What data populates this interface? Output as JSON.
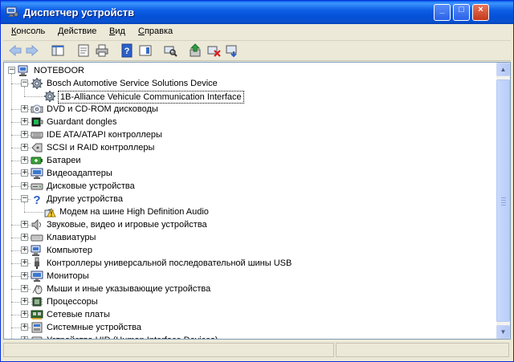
{
  "window": {
    "title": "Диспетчер устройств",
    "minimize": "_",
    "maximize": "□",
    "close": "×"
  },
  "menu": [
    "Консоль",
    "Действие",
    "Вид",
    "Справка"
  ],
  "toolbar": [
    "back-icon",
    "forward-icon",
    "console-tree-icon",
    "properties-icon",
    "print-icon",
    "help-icon",
    "show-hide-icon",
    "scan-hardware-icon",
    "update-driver-icon",
    "uninstall-icon",
    "disable-icon"
  ],
  "tree": [
    {
      "label": "NOTEBOOR",
      "level": 0,
      "expander": "−",
      "icon": "computer"
    },
    {
      "label": "Bosch Automotive Service Solutions Device",
      "level": 1,
      "expander": "−",
      "icon": "gear"
    },
    {
      "label": "1B-Alliance Vehicule Communication Interface",
      "level": 2,
      "expander": "",
      "icon": "gear",
      "selected": true
    },
    {
      "label": "DVD и CD-ROM дисководы",
      "level": 1,
      "expander": "+",
      "icon": "dvd"
    },
    {
      "label": "Guardant dongles",
      "level": 1,
      "expander": "+",
      "icon": "dongle"
    },
    {
      "label": "IDE ATA/ATAPI контроллеры",
      "level": 1,
      "expander": "+",
      "icon": "ide"
    },
    {
      "label": "SCSI и RAID контроллеры",
      "level": 1,
      "expander": "+",
      "icon": "scsi"
    },
    {
      "label": "Батареи",
      "level": 1,
      "expander": "+",
      "icon": "battery"
    },
    {
      "label": "Видеоадаптеры",
      "level": 1,
      "expander": "+",
      "icon": "display"
    },
    {
      "label": "Дисковые устройства",
      "level": 1,
      "expander": "+",
      "icon": "disk"
    },
    {
      "label": "Другие устройства",
      "level": 1,
      "expander": "−",
      "icon": "question"
    },
    {
      "label": "Модем на шине High Definition Audio",
      "level": 2,
      "expander": "",
      "icon": "warning"
    },
    {
      "label": "Звуковые, видео и игровые устройства",
      "level": 1,
      "expander": "+",
      "icon": "sound"
    },
    {
      "label": "Клавиатуры",
      "level": 1,
      "expander": "+",
      "icon": "keyboard"
    },
    {
      "label": "Компьютер",
      "level": 1,
      "expander": "+",
      "icon": "computer"
    },
    {
      "label": "Контроллеры универсальной последовательной шины USB",
      "level": 1,
      "expander": "+",
      "icon": "usb"
    },
    {
      "label": "Мониторы",
      "level": 1,
      "expander": "+",
      "icon": "display"
    },
    {
      "label": "Мыши и иные указывающие устройства",
      "level": 1,
      "expander": "+",
      "icon": "mouse"
    },
    {
      "label": "Процессоры",
      "level": 1,
      "expander": "+",
      "icon": "cpu"
    },
    {
      "label": "Сетевые платы",
      "level": 1,
      "expander": "+",
      "icon": "network"
    },
    {
      "label": "Системные устройства",
      "level": 1,
      "expander": "+",
      "icon": "system"
    },
    {
      "label": "Устройства HID (Human Interface Devices)",
      "level": 1,
      "expander": "+",
      "icon": "hid"
    }
  ],
  "scrollbar": {
    "up": "▲",
    "down": "▼"
  },
  "colors": {
    "titlebar": "#0a52cf",
    "selection_border": "#000000",
    "window_bg": "#ece9d8"
  }
}
